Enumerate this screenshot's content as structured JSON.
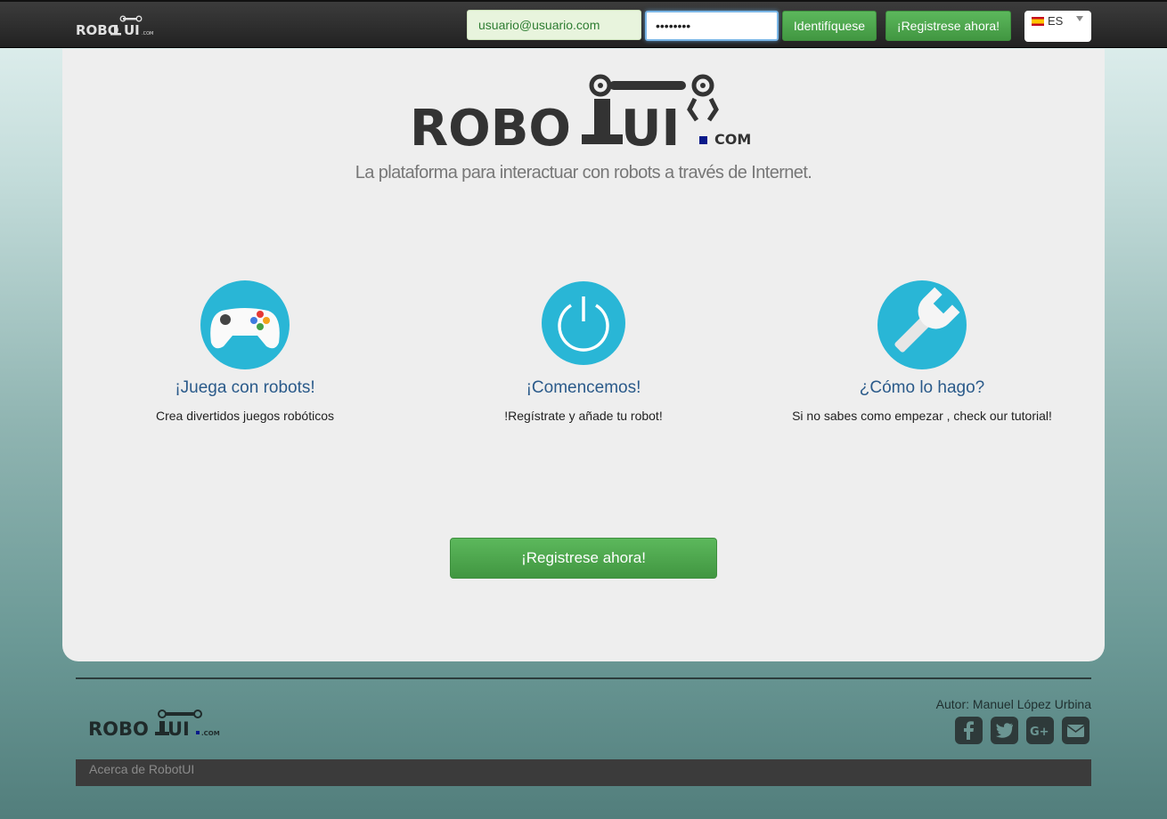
{
  "navbar": {
    "logo_text": "ROBOTUI.COM",
    "email_value": "usuario@usuario.com",
    "password_value": "••••••••",
    "login_label": "Identifíquese",
    "register_label": "¡Registrese ahora!",
    "language": {
      "selected": "ES",
      "flag_icon": "spain-flag-icon"
    }
  },
  "hero": {
    "logo_text": "ROBOTUI.COM",
    "tagline": "La plataforma para interactuar con robots a través de Internet."
  },
  "features": [
    {
      "icon": "gamepad-icon",
      "title": "¡Juega con robots!",
      "text": "Crea divertidos juegos robóticos"
    },
    {
      "icon": "power-icon",
      "title": "¡Comencemos!",
      "text": "!Regístrate y añade tu robot!"
    },
    {
      "icon": "wrench-icon",
      "title": "¿Cómo lo hago?",
      "text": "Si no sabes como empezar , check our tutorial!"
    }
  ],
  "cta": {
    "register_label": "¡Registrese ahora!"
  },
  "footer": {
    "logo_text": "ROBOTUI.COM",
    "author": "Autor: Manuel López Urbina",
    "social": [
      "facebook-icon",
      "twitter-icon",
      "google-plus-icon",
      "envelope-icon"
    ],
    "about_link": "Acerca de RobotUI"
  },
  "colors": {
    "accent_green": "#5cb85c",
    "icon_circle": "#29b6d6",
    "title_blue": "#2a5a8a",
    "navbar": "#2a2a2a"
  }
}
